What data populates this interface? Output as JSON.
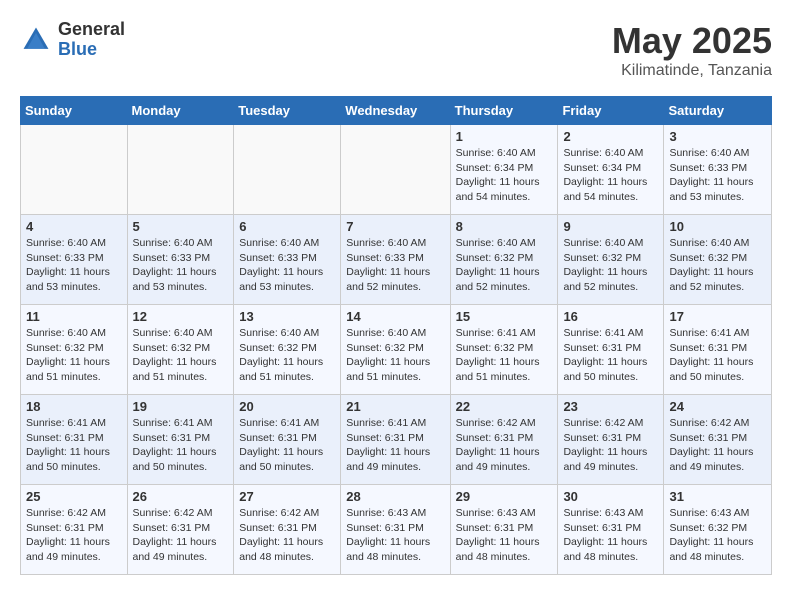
{
  "logo": {
    "general": "General",
    "blue": "Blue"
  },
  "title": {
    "month_year": "May 2025",
    "location": "Kilimatinde, Tanzania"
  },
  "days_of_week": [
    "Sunday",
    "Monday",
    "Tuesday",
    "Wednesday",
    "Thursday",
    "Friday",
    "Saturday"
  ],
  "weeks": [
    [
      {
        "day": "",
        "info": ""
      },
      {
        "day": "",
        "info": ""
      },
      {
        "day": "",
        "info": ""
      },
      {
        "day": "",
        "info": ""
      },
      {
        "day": "1",
        "info": "Sunrise: 6:40 AM\nSunset: 6:34 PM\nDaylight: 11 hours\nand 54 minutes."
      },
      {
        "day": "2",
        "info": "Sunrise: 6:40 AM\nSunset: 6:34 PM\nDaylight: 11 hours\nand 54 minutes."
      },
      {
        "day": "3",
        "info": "Sunrise: 6:40 AM\nSunset: 6:33 PM\nDaylight: 11 hours\nand 53 minutes."
      }
    ],
    [
      {
        "day": "4",
        "info": "Sunrise: 6:40 AM\nSunset: 6:33 PM\nDaylight: 11 hours\nand 53 minutes."
      },
      {
        "day": "5",
        "info": "Sunrise: 6:40 AM\nSunset: 6:33 PM\nDaylight: 11 hours\nand 53 minutes."
      },
      {
        "day": "6",
        "info": "Sunrise: 6:40 AM\nSunset: 6:33 PM\nDaylight: 11 hours\nand 53 minutes."
      },
      {
        "day": "7",
        "info": "Sunrise: 6:40 AM\nSunset: 6:33 PM\nDaylight: 11 hours\nand 52 minutes."
      },
      {
        "day": "8",
        "info": "Sunrise: 6:40 AM\nSunset: 6:32 PM\nDaylight: 11 hours\nand 52 minutes."
      },
      {
        "day": "9",
        "info": "Sunrise: 6:40 AM\nSunset: 6:32 PM\nDaylight: 11 hours\nand 52 minutes."
      },
      {
        "day": "10",
        "info": "Sunrise: 6:40 AM\nSunset: 6:32 PM\nDaylight: 11 hours\nand 52 minutes."
      }
    ],
    [
      {
        "day": "11",
        "info": "Sunrise: 6:40 AM\nSunset: 6:32 PM\nDaylight: 11 hours\nand 51 minutes."
      },
      {
        "day": "12",
        "info": "Sunrise: 6:40 AM\nSunset: 6:32 PM\nDaylight: 11 hours\nand 51 minutes."
      },
      {
        "day": "13",
        "info": "Sunrise: 6:40 AM\nSunset: 6:32 PM\nDaylight: 11 hours\nand 51 minutes."
      },
      {
        "day": "14",
        "info": "Sunrise: 6:40 AM\nSunset: 6:32 PM\nDaylight: 11 hours\nand 51 minutes."
      },
      {
        "day": "15",
        "info": "Sunrise: 6:41 AM\nSunset: 6:32 PM\nDaylight: 11 hours\nand 51 minutes."
      },
      {
        "day": "16",
        "info": "Sunrise: 6:41 AM\nSunset: 6:31 PM\nDaylight: 11 hours\nand 50 minutes."
      },
      {
        "day": "17",
        "info": "Sunrise: 6:41 AM\nSunset: 6:31 PM\nDaylight: 11 hours\nand 50 minutes."
      }
    ],
    [
      {
        "day": "18",
        "info": "Sunrise: 6:41 AM\nSunset: 6:31 PM\nDaylight: 11 hours\nand 50 minutes."
      },
      {
        "day": "19",
        "info": "Sunrise: 6:41 AM\nSunset: 6:31 PM\nDaylight: 11 hours\nand 50 minutes."
      },
      {
        "day": "20",
        "info": "Sunrise: 6:41 AM\nSunset: 6:31 PM\nDaylight: 11 hours\nand 50 minutes."
      },
      {
        "day": "21",
        "info": "Sunrise: 6:41 AM\nSunset: 6:31 PM\nDaylight: 11 hours\nand 49 minutes."
      },
      {
        "day": "22",
        "info": "Sunrise: 6:42 AM\nSunset: 6:31 PM\nDaylight: 11 hours\nand 49 minutes."
      },
      {
        "day": "23",
        "info": "Sunrise: 6:42 AM\nSunset: 6:31 PM\nDaylight: 11 hours\nand 49 minutes."
      },
      {
        "day": "24",
        "info": "Sunrise: 6:42 AM\nSunset: 6:31 PM\nDaylight: 11 hours\nand 49 minutes."
      }
    ],
    [
      {
        "day": "25",
        "info": "Sunrise: 6:42 AM\nSunset: 6:31 PM\nDaylight: 11 hours\nand 49 minutes."
      },
      {
        "day": "26",
        "info": "Sunrise: 6:42 AM\nSunset: 6:31 PM\nDaylight: 11 hours\nand 49 minutes."
      },
      {
        "day": "27",
        "info": "Sunrise: 6:42 AM\nSunset: 6:31 PM\nDaylight: 11 hours\nand 48 minutes."
      },
      {
        "day": "28",
        "info": "Sunrise: 6:43 AM\nSunset: 6:31 PM\nDaylight: 11 hours\nand 48 minutes."
      },
      {
        "day": "29",
        "info": "Sunrise: 6:43 AM\nSunset: 6:31 PM\nDaylight: 11 hours\nand 48 minutes."
      },
      {
        "day": "30",
        "info": "Sunrise: 6:43 AM\nSunset: 6:31 PM\nDaylight: 11 hours\nand 48 minutes."
      },
      {
        "day": "31",
        "info": "Sunrise: 6:43 AM\nSunset: 6:32 PM\nDaylight: 11 hours\nand 48 minutes."
      }
    ]
  ]
}
